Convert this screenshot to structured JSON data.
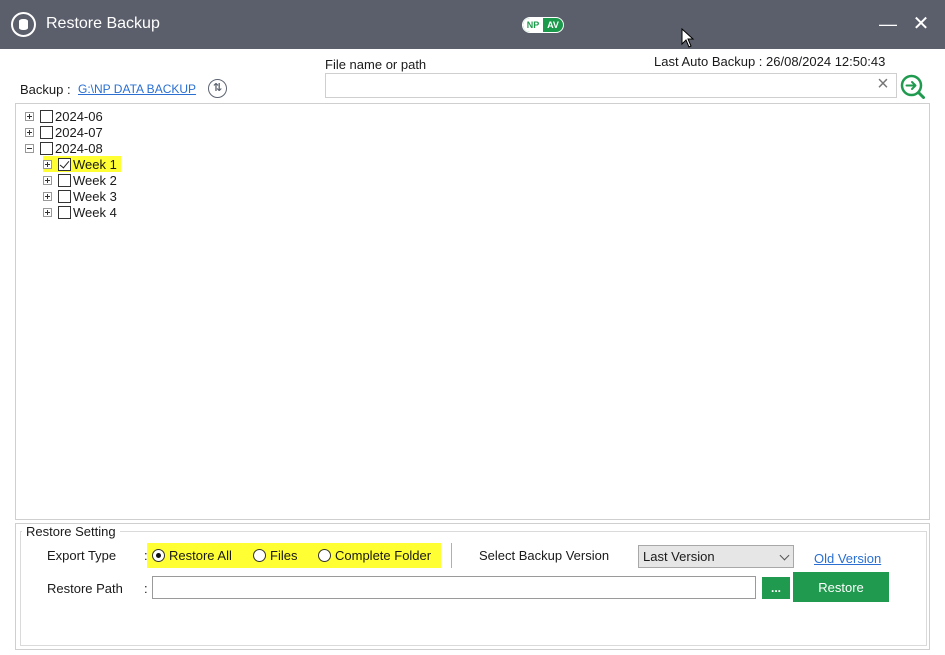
{
  "window": {
    "title": "Restore Backup",
    "logo_left": "NP",
    "logo_right": "AV",
    "minimize_glyph": "—",
    "close_glyph": "✕"
  },
  "backup": {
    "label": "Backup :",
    "path": "G:\\NP DATA BACKUP"
  },
  "search": {
    "label": "File name or path",
    "value": "",
    "placeholder": ""
  },
  "last_auto_backup": "Last Auto Backup : 26/08/2024 12:50:43",
  "tree": {
    "nodes": [
      {
        "label": "2024-06",
        "expanded": false,
        "checked": false,
        "level": 0
      },
      {
        "label": "2024-07",
        "expanded": false,
        "checked": false,
        "level": 0
      },
      {
        "label": "2024-08",
        "expanded": true,
        "checked": false,
        "level": 0
      },
      {
        "label": "Week 1",
        "expanded": false,
        "checked": true,
        "level": 1,
        "highlighted": true
      },
      {
        "label": "Week 2",
        "expanded": false,
        "checked": false,
        "level": 1
      },
      {
        "label": "Week 3",
        "expanded": false,
        "checked": false,
        "level": 1
      },
      {
        "label": "Week 4",
        "expanded": false,
        "checked": false,
        "level": 1
      }
    ]
  },
  "restore_setting": {
    "title": "Restore Setting",
    "export_type_label": "Export Type",
    "colon": ":",
    "options": [
      {
        "label": "Restore All",
        "selected": true
      },
      {
        "label": "Files",
        "selected": false
      },
      {
        "label": "Complete Folder",
        "selected": false
      }
    ],
    "select_version_label": "Select Backup Version",
    "version_value": "Last Version",
    "old_version_link": "Old Version",
    "restore_path_label": "Restore Path",
    "restore_path_value": "",
    "browse_label": "...",
    "restore_button": "Restore"
  },
  "colors": {
    "titlebar": "#5b5f6b",
    "accent_green": "#1f9a4e",
    "highlight": "#ffff33",
    "link": "#2a6fd1"
  }
}
